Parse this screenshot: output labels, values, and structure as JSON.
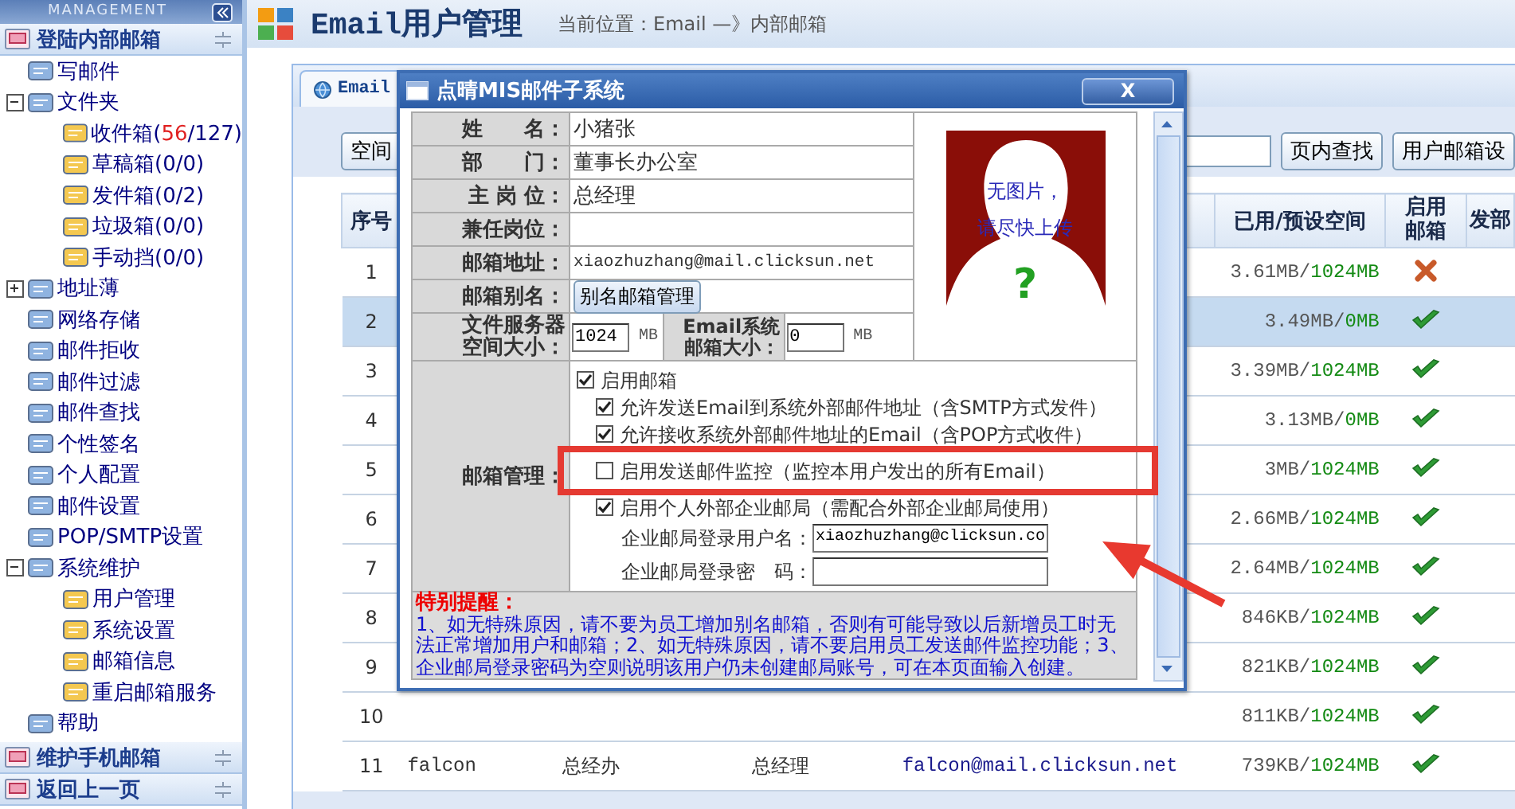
{
  "sidebar": {
    "brand": "MANAGEMENT",
    "sections": [
      {
        "title": "登陆内部邮箱",
        "items": [
          {
            "label": "写邮件"
          },
          {
            "label": "文件夹",
            "expanded": true,
            "children": [
              {
                "label": "收件箱",
                "count": [
                  {
                    "kind": "plain",
                    "text": "("
                  },
                  {
                    "kind": "unread",
                    "text": "56"
                  },
                  {
                    "kind": "plain",
                    "text": "/127)"
                  }
                ]
              },
              {
                "label": "草稿箱",
                "count": [
                  {
                    "kind": "plain",
                    "text": "(0/0)"
                  }
                ]
              },
              {
                "label": "发件箱",
                "count": [
                  {
                    "kind": "plain",
                    "text": "(0/2)"
                  }
                ]
              },
              {
                "label": "垃圾箱",
                "count": [
                  {
                    "kind": "plain",
                    "text": "(0/0)"
                  }
                ]
              },
              {
                "label": "手动挡",
                "count": [
                  {
                    "kind": "plain",
                    "text": "(0/0)"
                  }
                ]
              }
            ]
          },
          {
            "label": "地址薄",
            "expanded": false
          },
          {
            "label": "网络存储"
          },
          {
            "label": "邮件拒收"
          },
          {
            "label": "邮件过滤"
          },
          {
            "label": "邮件查找"
          },
          {
            "label": "个性签名"
          },
          {
            "label": "个人配置"
          },
          {
            "label": "邮件设置"
          },
          {
            "label": "POP/SMTP设置"
          },
          {
            "label": "系统维护",
            "expanded": true,
            "children": [
              {
                "label": "用户管理"
              },
              {
                "label": "系统设置"
              },
              {
                "label": "邮箱信息"
              },
              {
                "label": "重启邮箱服务"
              }
            ]
          },
          {
            "label": "帮助"
          }
        ]
      },
      {
        "title": "维护手机邮箱"
      },
      {
        "title": "返回上一页"
      }
    ]
  },
  "header": {
    "title": "Email用户管理",
    "breadcrumb": "当前位置：Email —》内部邮箱"
  },
  "panel": {
    "tab": "Email",
    "scope_button": "空间",
    "buttons": [
      "页内查找",
      "用户邮箱设"
    ]
  },
  "table": {
    "columns": [
      {
        "label": "序号"
      },
      {},
      {},
      {},
      {},
      {
        "label": "已用/预设空间"
      },
      {
        "label": "启用邮箱"
      },
      {
        "label": "发部"
      }
    ],
    "rows": [
      {
        "number": "1",
        "used": "3.61MB/",
        "quota": "1024MB",
        "enabled": false,
        "selected": false
      },
      {
        "number": "2",
        "used": "3.49MB/",
        "quota": "0MB",
        "enabled": true,
        "selected": true
      },
      {
        "number": "3",
        "used": "3.39MB/",
        "quota": "1024MB",
        "enabled": true,
        "selected": false
      },
      {
        "number": "4",
        "used": "3.13MB/",
        "quota": "0MB",
        "enabled": true,
        "selected": false
      },
      {
        "number": "5",
        "used": "3MB/",
        "quota": "1024MB",
        "enabled": true,
        "selected": false
      },
      {
        "number": "6",
        "used": "2.66MB/",
        "quota": "1024MB",
        "enabled": true,
        "selected": false
      },
      {
        "number": "7",
        "used": "2.64MB/",
        "quota": "1024MB",
        "enabled": true,
        "selected": false
      },
      {
        "number": "8",
        "used": "846KB/",
        "quota": "1024MB",
        "enabled": true,
        "selected": false
      },
      {
        "number": "9",
        "used": "821KB/",
        "quota": "1024MB",
        "enabled": true,
        "selected": false
      },
      {
        "number": "10",
        "used": "811KB/",
        "quota": "1024MB",
        "enabled": true,
        "selected": false
      },
      {
        "number": "11",
        "name": "falcon",
        "department": "总经办",
        "position": "总经理",
        "email": "falcon@mail.clicksun.net",
        "used": "739KB/",
        "quota": "1024MB",
        "enabled": true,
        "selected": false
      }
    ]
  },
  "dialog": {
    "title": "点晴MIS邮件子系统",
    "close": "X",
    "fields": [
      {
        "kind": "text",
        "label": "姓　　名：",
        "value": "小猪张"
      },
      {
        "kind": "text",
        "label": "部　　门：",
        "value": "董事长办公室"
      },
      {
        "kind": "text",
        "label": "主 岗 位：",
        "value": "总经理"
      },
      {
        "kind": "text",
        "label": "兼任岗位："
      },
      {
        "kind": "email",
        "label": "邮箱地址：",
        "value": "xiaozhuzhang@mail.clicksun.net"
      },
      {
        "kind": "button",
        "label": "邮箱别名：",
        "value": "别名邮箱管理"
      },
      {
        "kind": "sizes",
        "label": "文件服务器空间大小：",
        "value": "1024",
        "unit": "MB",
        "label2": "Email系统邮箱大小：",
        "value2": "0",
        "unit2": "MB"
      }
    ],
    "photo": {
      "line1": "无图片，",
      "line2": "请尽快上传",
      "mark": "?"
    },
    "management": {
      "label": "邮箱管理：",
      "items": [
        {
          "kind": "checkbox",
          "label": "启用邮箱",
          "checked": true,
          "children": [
            {
              "kind": "checkbox",
              "label": "允许发送Email到系统外部邮件地址（含SMTP方式发件）",
              "checked": true
            },
            {
              "kind": "checkbox",
              "label": "允许接收系统外部邮件地址的Email（含POP方式收件）",
              "checked": true
            },
            {
              "kind": "checkbox",
              "label": "启用发送邮件监控（监控本用户发出的所有Email）",
              "checked": false,
              "highlighted": true
            },
            {
              "kind": "checkbox",
              "label": "启用个人外部企业邮局（需配合外部企业邮局使用）",
              "checked": true,
              "children": [
                {
                  "kind": "field",
                  "label": "企业邮局登录用户名：",
                  "value": "xiaozhuzhang@clicksun.co"
                },
                {
                  "kind": "field",
                  "label": "企业邮局登录密　码："
                }
              ]
            }
          ]
        }
      ]
    },
    "notice": {
      "title": "特别提醒：",
      "text": "1、如无特殊原因，请不要为员工增加别名邮箱，否则有可能导致以后新增员工时无法正常增加用户和邮箱；2、如无特殊原因，请不要启用员工发送邮件监控功能；3、企业邮局登录密码为空则说明该用户仍未创建邮局账号，可在本页面输入创建。"
    }
  }
}
